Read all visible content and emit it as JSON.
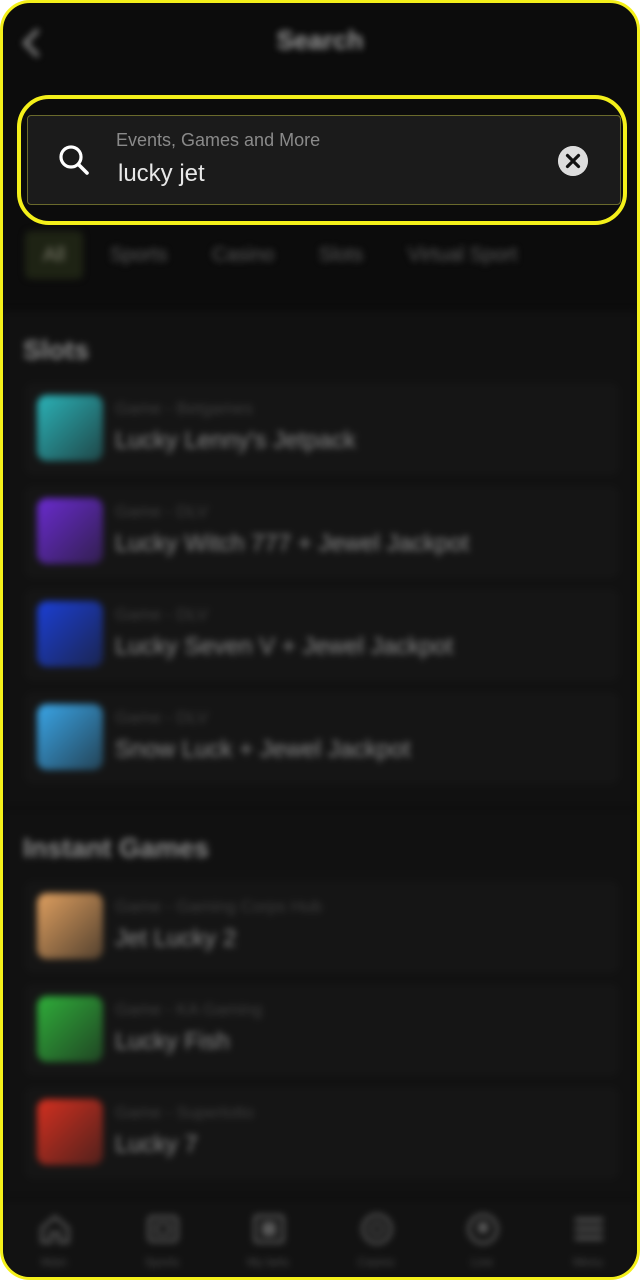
{
  "header": {
    "title": "Search",
    "back_icon": "chevron-left-icon"
  },
  "search": {
    "placeholder": "Events, Games and More",
    "value": "lucky jet",
    "search_icon": "search-icon",
    "clear_icon": "clear-circle-icon"
  },
  "filters": {
    "tabs": [
      {
        "label": "All",
        "active": true
      },
      {
        "label": "Sports",
        "active": false
      },
      {
        "label": "Casino",
        "active": false
      },
      {
        "label": "Slots",
        "active": false
      },
      {
        "label": "Virtual Sport",
        "active": false
      }
    ]
  },
  "sections": [
    {
      "title": "Slots",
      "items": [
        {
          "meta": "Game - Betgames",
          "name": "Lucky Lenny's Jetpack",
          "thumb_color": "#2bb3b8"
        },
        {
          "meta": "Game - DLV",
          "name": "Lucky Witch 777 + Jewel Jackpot",
          "thumb_color": "#6a2bd0"
        },
        {
          "meta": "Game - DLV",
          "name": "Lucky Seven V + Jewel Jackpot",
          "thumb_color": "#1b3fd6"
        },
        {
          "meta": "Game - DLV",
          "name": "Snow Luck + Jewel Jackpot",
          "thumb_color": "#3aa6e8"
        }
      ]
    },
    {
      "title": "Instant Games",
      "items": [
        {
          "meta": "Game - Gaming Corps Hub",
          "name": "Jet Lucky 2",
          "thumb_color": "#e0a060"
        },
        {
          "meta": "Game - KA Gaming",
          "name": "Lucky Fish",
          "thumb_color": "#2fae3a"
        },
        {
          "meta": "Game - Superlotto",
          "name": "Lucky 7",
          "thumb_color": "#d43020"
        }
      ]
    }
  ],
  "bottom_nav": [
    {
      "label": "Main",
      "icon": "home-icon"
    },
    {
      "label": "Sports",
      "icon": "sports-icon"
    },
    {
      "label": "My bets",
      "icon": "ticket-icon"
    },
    {
      "label": "Casino",
      "icon": "chip-icon"
    },
    {
      "label": "Live",
      "icon": "ball-icon"
    },
    {
      "label": "Menu",
      "icon": "menu-icon"
    }
  ],
  "colors": {
    "accent": "#f4f01a",
    "background": "#0c0c0c"
  }
}
